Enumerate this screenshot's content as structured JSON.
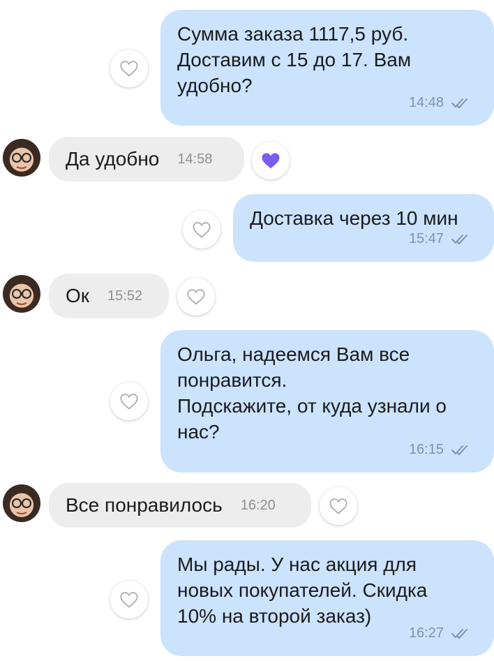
{
  "messages": [
    {
      "text": "Сумма заказа 1117,5 руб.\nДоставим  с 15 до 17. Вам\nудобно?",
      "time": "14:48"
    },
    {
      "text": "Да удобно",
      "time": "14:58"
    },
    {
      "text": "Доставка через 10 мин",
      "time": "15:47"
    },
    {
      "text": "Ок",
      "time": "15:52"
    },
    {
      "text": "Ольга, надеемся Вам все\nпонравится.\nПодскажите, от куда узнали о\nнас?",
      "time": "16:15"
    },
    {
      "text": "Все понравилось",
      "time": "16:20"
    },
    {
      "text": "Мы рады. У нас акция для\nновых покупателей. Скидка\n10% на второй заказ)",
      "time": "16:27"
    }
  ],
  "icons": {
    "heart_outline": "heart-outline-icon",
    "heart_filled": "heart-filled-icon",
    "read_receipt": "double-check-icon",
    "avatar": "user-avatar"
  },
  "colors": {
    "outgoing_bubble": "#cbe3fd",
    "incoming_bubble": "#ededee",
    "like_active": "#7b5cf0",
    "meta_text": "#7f93a6"
  }
}
